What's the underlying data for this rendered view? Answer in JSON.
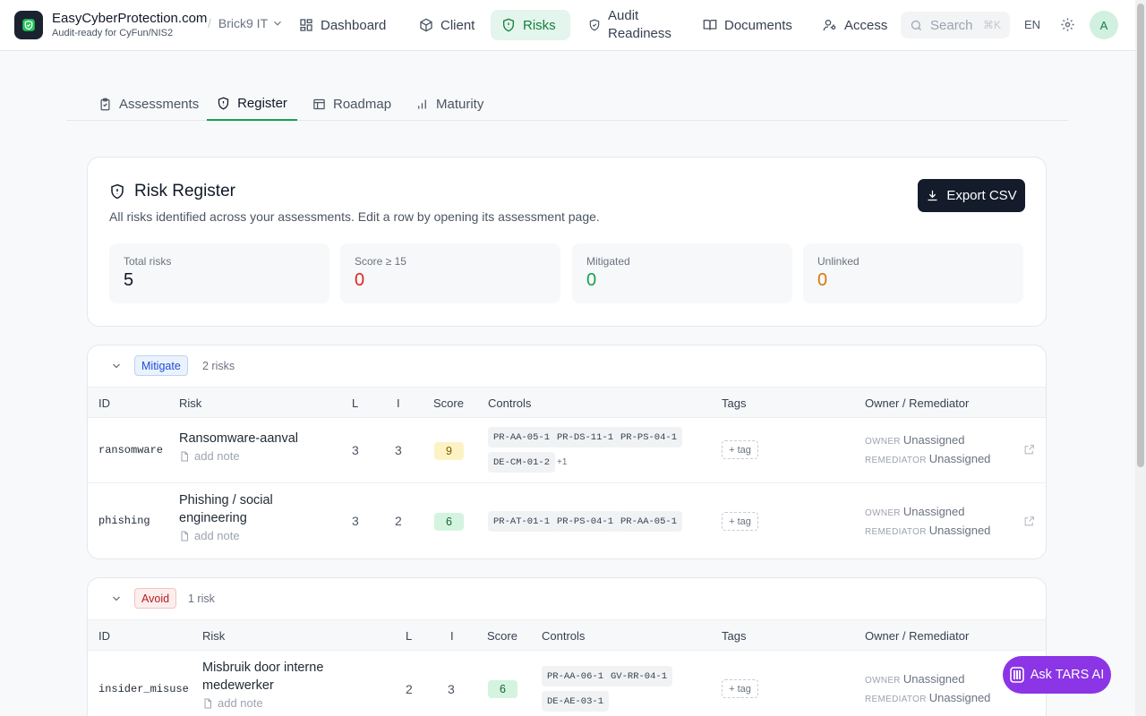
{
  "header": {
    "brand_name": "EasyCyberProtection.com",
    "brand_tagline": "Audit-ready for CyFun/NIS2",
    "workspace": "Brick9 IT",
    "nav": [
      {
        "label": "Dashboard",
        "icon": "dashboard-icon"
      },
      {
        "label": "Client",
        "icon": "cube-icon"
      },
      {
        "label": "Risks",
        "icon": "shield-icon",
        "active": true
      },
      {
        "label": "Audit Readiness",
        "icon": "shield-check-icon"
      },
      {
        "label": "Documents",
        "icon": "book-icon"
      },
      {
        "label": "Access",
        "icon": "user-key-icon"
      }
    ],
    "search_placeholder": "Search",
    "search_shortcut": "⌘K",
    "language": "EN",
    "avatar_initial": "A"
  },
  "tabs": [
    {
      "label": "Assessments",
      "icon": "clipboard-check-icon"
    },
    {
      "label": "Register",
      "icon": "shield-icon",
      "active": true
    },
    {
      "label": "Roadmap",
      "icon": "layout-icon"
    },
    {
      "label": "Maturity",
      "icon": "bar-chart-icon"
    }
  ],
  "register": {
    "title": "Risk Register",
    "description": "All risks identified across your assessments. Edit a row by opening its assessment page.",
    "export_label": "Export CSV",
    "stats": [
      {
        "label": "Total risks",
        "value": "5",
        "color": "#111827"
      },
      {
        "label": "Score ≥ 15",
        "value": "0",
        "color": "#dc2626"
      },
      {
        "label": "Mitigated",
        "value": "0",
        "color": "#16a34a"
      },
      {
        "label": "Unlinked",
        "value": "0",
        "color": "#d97706"
      }
    ]
  },
  "columns": {
    "id": "ID",
    "risk": "Risk",
    "l": "L",
    "i": "I",
    "score": "Score",
    "controls": "Controls",
    "tags": "Tags",
    "owner": "Owner / Remediator"
  },
  "labels": {
    "add_note": "add note",
    "tag": "+ tag",
    "owner_key": "OWNER",
    "remediator_key": "REMEDIATOR",
    "unassigned": "Unassigned"
  },
  "groups": [
    {
      "treatment": "Mitigate",
      "count_label": "2 risks",
      "rows": [
        {
          "id": "ransomware",
          "name_lines": [
            "Ransomware-aanval"
          ],
          "l": "3",
          "i": "3",
          "score": "9",
          "controls": [
            "PR-AA-05-1",
            "PR-DS-11-1",
            "PR-PS-04-1",
            "DE-CM-01-2"
          ],
          "more": "+1"
        },
        {
          "id": "phishing",
          "name_lines": [
            "Phishing / social",
            "engineering"
          ],
          "l": "3",
          "i": "2",
          "score": "6",
          "controls": [
            "PR-AT-01-1",
            "PR-PS-04-1",
            "PR-AA-05-1"
          ]
        }
      ]
    },
    {
      "treatment": "Avoid",
      "count_label": "1 risk",
      "rows": [
        {
          "id": "insider_misuse",
          "name_lines": [
            "Misbruik door interne",
            "medewerker"
          ],
          "l": "2",
          "i": "3",
          "score": "6",
          "controls": [
            "PR-AA-06-1",
            "GV-RR-04-1",
            "DE-AE-03-1"
          ]
        }
      ]
    }
  ],
  "assistant_label": "Ask TARS AI"
}
